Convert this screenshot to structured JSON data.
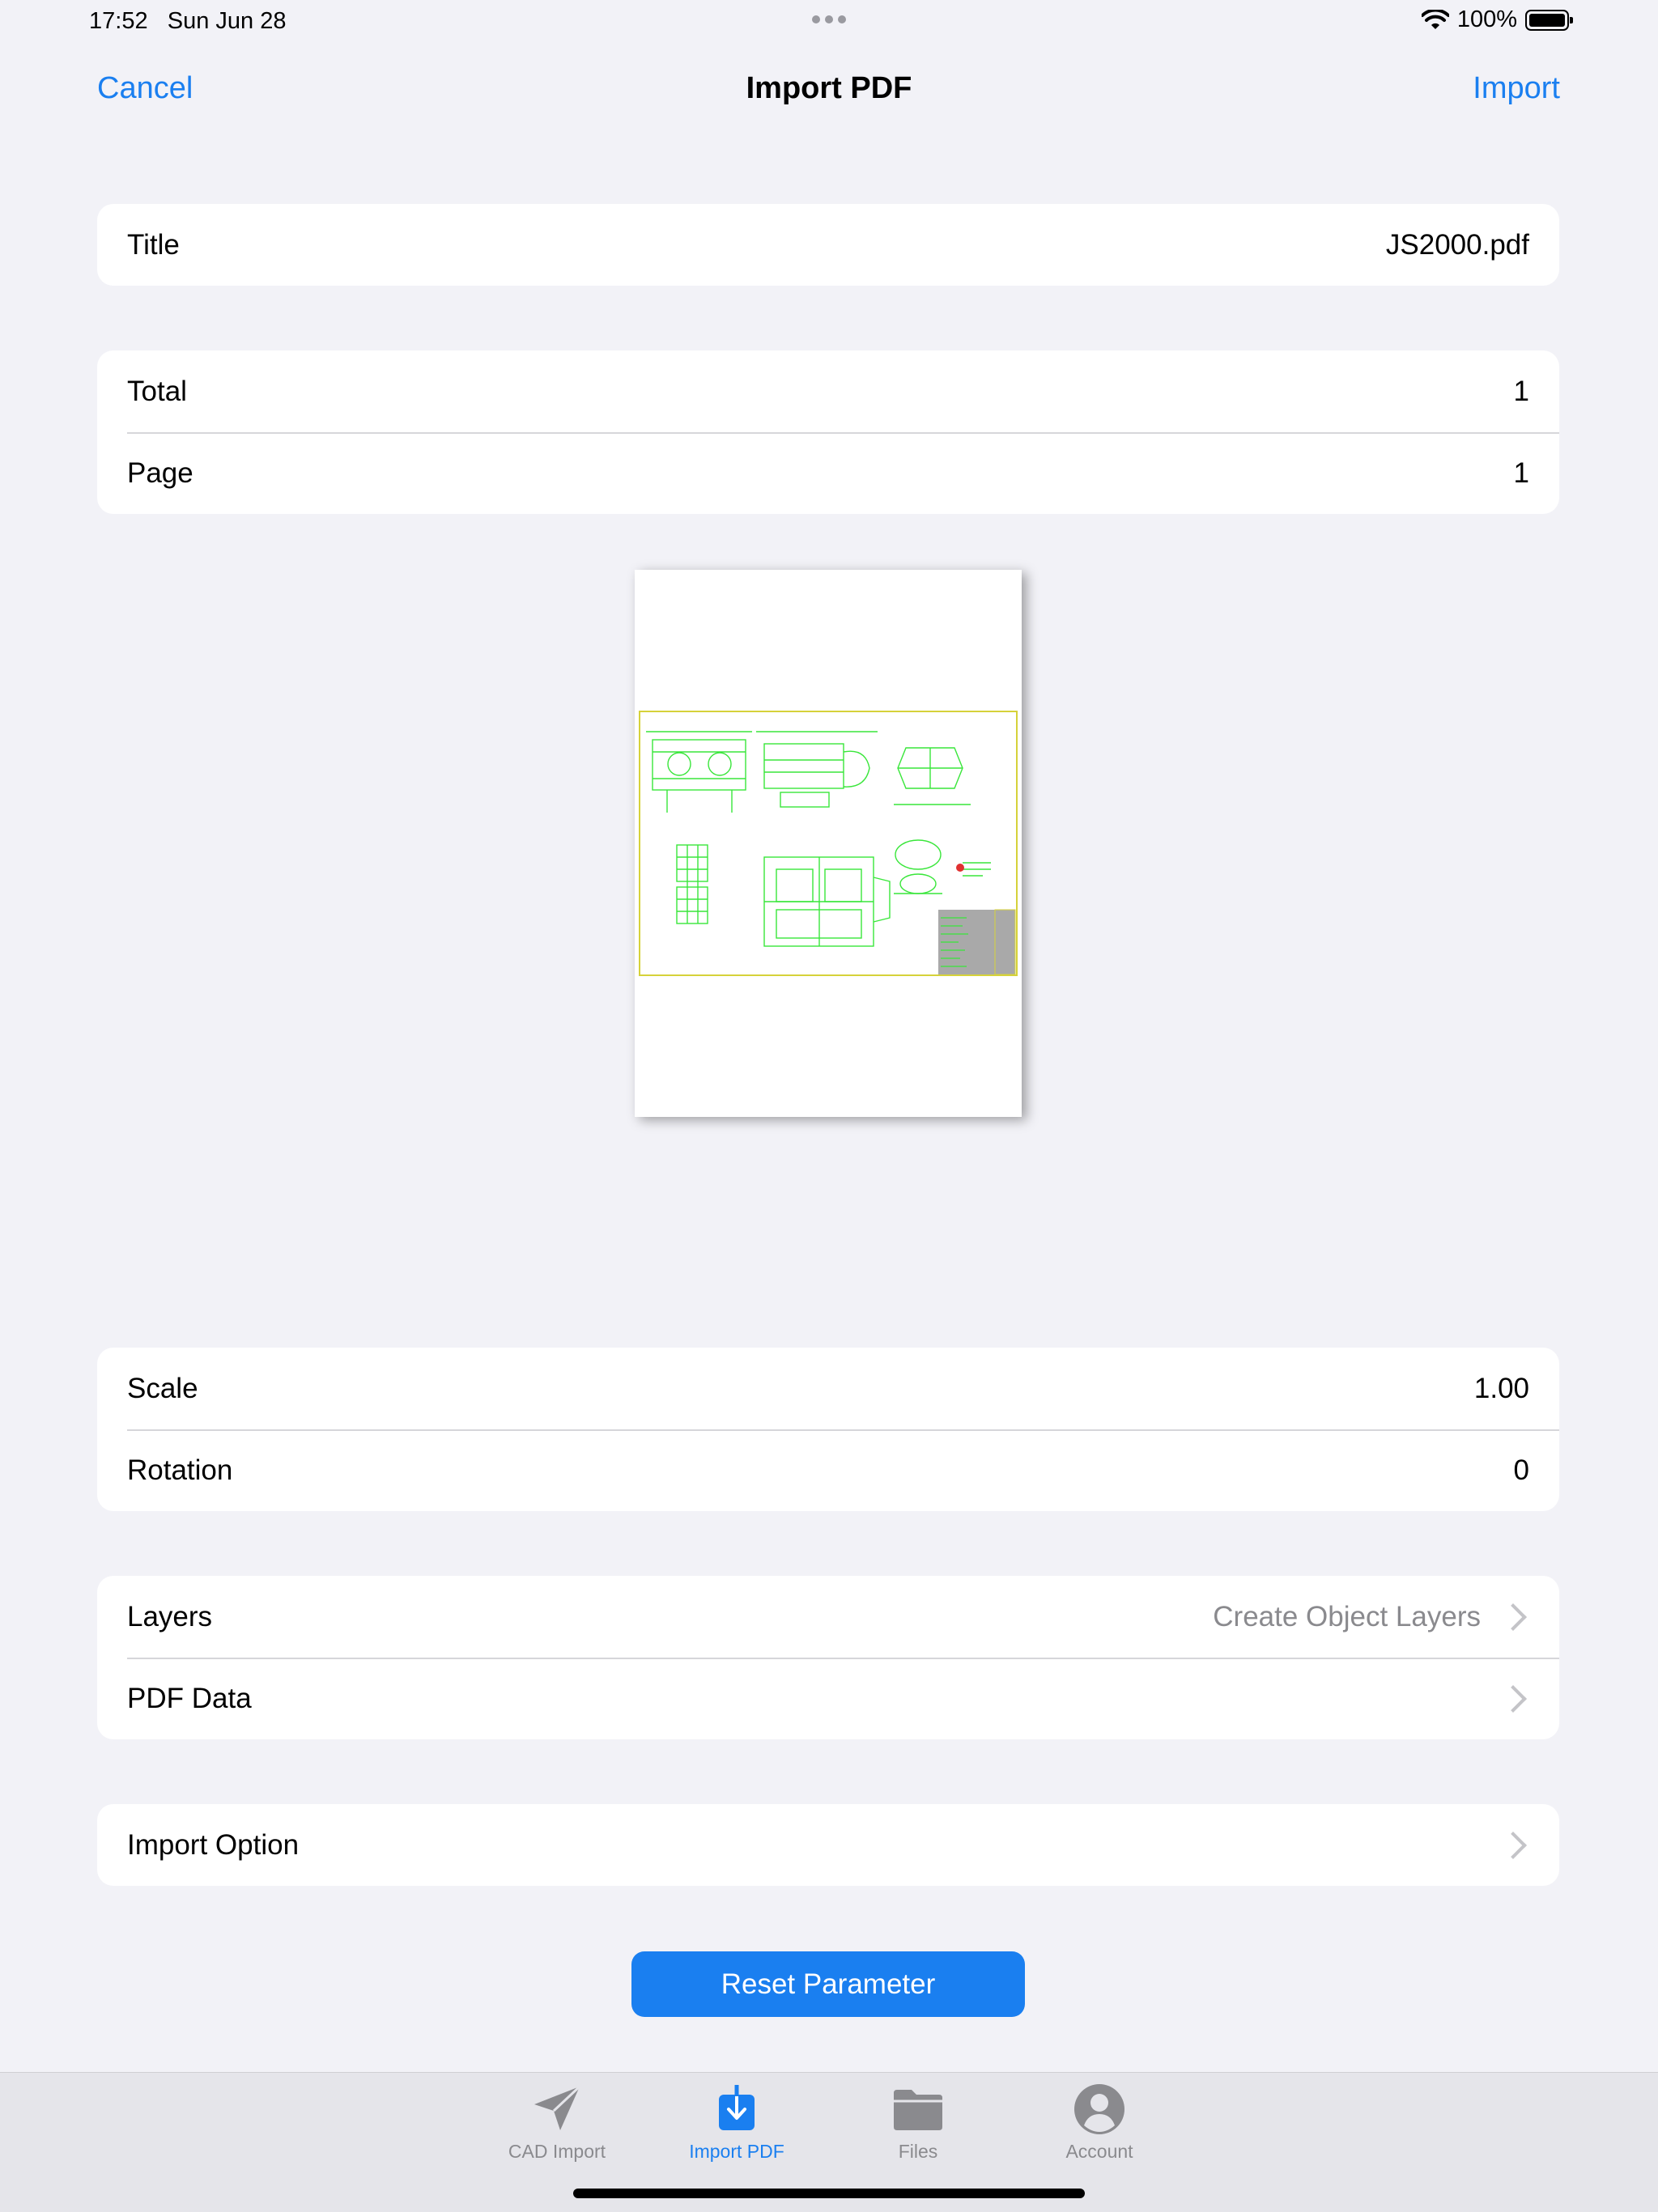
{
  "status_bar": {
    "time": "17:52",
    "date": "Sun Jun 28",
    "battery": "100%"
  },
  "nav": {
    "cancel": "Cancel",
    "title": "Import PDF",
    "import": "Import"
  },
  "file": {
    "title_label": "Title",
    "title_value": "JS2000.pdf"
  },
  "pages": {
    "total_label": "Total",
    "total_value": "1",
    "page_label": "Page",
    "page_value": "1"
  },
  "transform": {
    "scale_label": "Scale",
    "scale_value": "1.00",
    "rotation_label": "Rotation",
    "rotation_value": "0"
  },
  "data_options": {
    "layers_label": "Layers",
    "layers_value": "Create Object Layers",
    "pdf_data_label": "PDF Data"
  },
  "import_option": {
    "label": "Import Option"
  },
  "reset_button": "Reset Parameter",
  "tabs": [
    {
      "label": "CAD Import",
      "icon": "paper-plane-icon",
      "active": false
    },
    {
      "label": "Import PDF",
      "icon": "import-pdf-icon",
      "active": true
    },
    {
      "label": "Files",
      "icon": "folder-icon",
      "active": false
    },
    {
      "label": "Account",
      "icon": "person-circle-icon",
      "active": false
    }
  ],
  "colors": {
    "accent": "#1a7ff0",
    "background": "#f2f2f7",
    "cad_lines": "#39e63a",
    "cad_frame": "#d6d23a"
  }
}
